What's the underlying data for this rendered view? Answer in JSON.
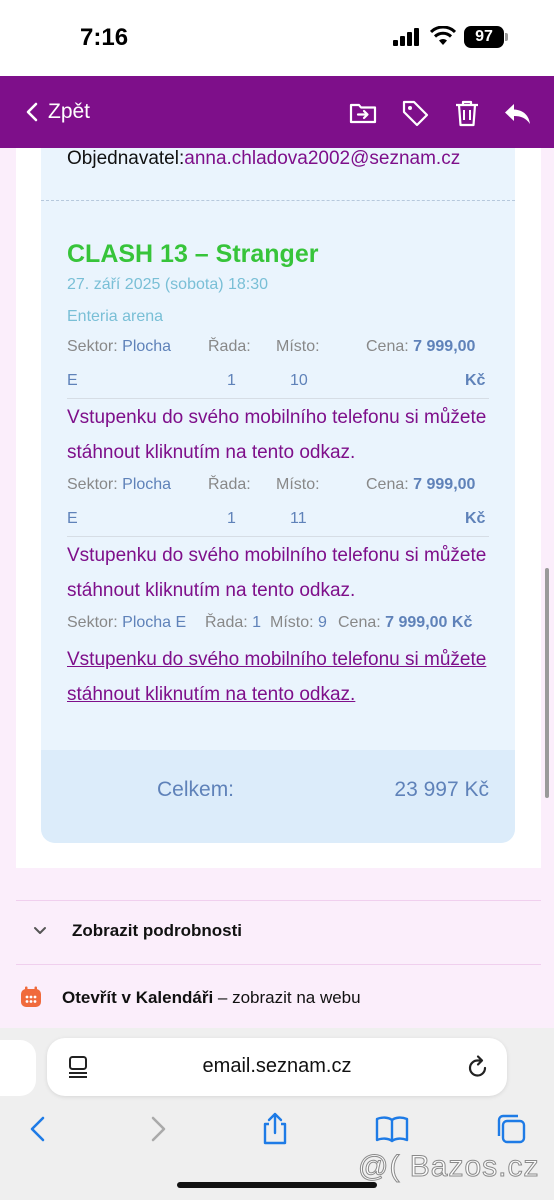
{
  "status_bar": {
    "time": "7:16",
    "battery": "97"
  },
  "toolbar": {
    "back_label": "Zpět"
  },
  "email": {
    "orderer_label": "Objednavatel:",
    "orderer_email": "anna.chladova2002@seznam.cz",
    "event": {
      "title": "CLASH 13 – Stranger",
      "date": "27. září 2025 (sobota) 18:30",
      "venue": "Enteria arena"
    },
    "tickets": [
      {
        "sector_label": "Sektor:",
        "sector": "Plocha",
        "sector_suffix": "E",
        "row_label": "Řada:",
        "row": "1",
        "seat_label": "Místo:",
        "seat": "10",
        "price_label": "Cena:",
        "price": "7 999,00",
        "currency": "Kč",
        "download": "Vstupenku do svého mobilního telefonu si můžete stáhnout kliknutím na tento odkaz."
      },
      {
        "sector_label": "Sektor:",
        "sector": "Plocha",
        "sector_suffix": "E",
        "row_label": "Řada:",
        "row": "1",
        "seat_label": "Místo:",
        "seat": "11",
        "price_label": "Cena:",
        "price": "7 999,00",
        "currency": "Kč",
        "download": "Vstupenku do svého mobilního telefonu si můžete stáhnout kliknutím na tento odkaz."
      },
      {
        "sector_label": "Sektor:",
        "sector": "Plocha E",
        "row_label": "Řada:",
        "row": "1",
        "seat_label": "Místo:",
        "seat": "9",
        "price_label": "Cena:",
        "price": "7 999,00 Kč",
        "download": "Vstupenku do svého mobilního telefonu si můžete stáhnout kliknutím na tento odkaz."
      }
    ],
    "total_label": "Celkem:",
    "total_value": "23 997 Kč"
  },
  "details": {
    "label": "Zobrazit podrobnosti"
  },
  "calendar": {
    "bold": "Otevřít v Kalendáři",
    "rest": " – zobrazit na webu"
  },
  "browser": {
    "url": "email.seznam.cz"
  },
  "watermark": "@( Bazos.cz",
  "colors": {
    "toolbar": "#7e0f8a",
    "title_green": "#37c43a",
    "link_purple": "#7e0f8a",
    "value_blue": "#5f82b9"
  }
}
